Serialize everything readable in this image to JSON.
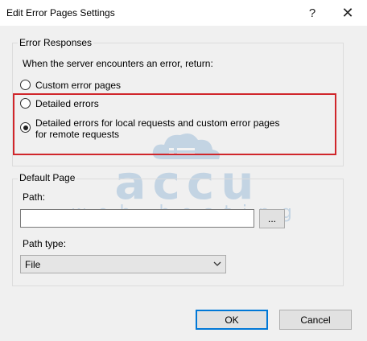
{
  "window": {
    "title": "Edit Error Pages Settings",
    "help_glyph": "?",
    "close_glyph": "✕"
  },
  "error_responses": {
    "group_label": "Error Responses",
    "prompt": "When the server encounters an error, return:",
    "options": [
      {
        "label": "Custom error pages",
        "selected": false
      },
      {
        "label": "Detailed errors",
        "selected": false
      },
      {
        "label_line1": "Detailed errors for local requests and custom error pages",
        "label_line2": "for remote requests",
        "selected": true
      }
    ]
  },
  "default_page": {
    "group_label": "Default Page",
    "path_label": "Path:",
    "path_value": "",
    "browse_label": "...",
    "path_type_label": "Path type:",
    "path_type_value": "File"
  },
  "buttons": {
    "ok": "OK",
    "cancel": "Cancel"
  },
  "watermark": {
    "main": "accu",
    "sub": "web hosting"
  },
  "colors": {
    "highlight": "#d0262b",
    "accent": "#0078d7"
  }
}
